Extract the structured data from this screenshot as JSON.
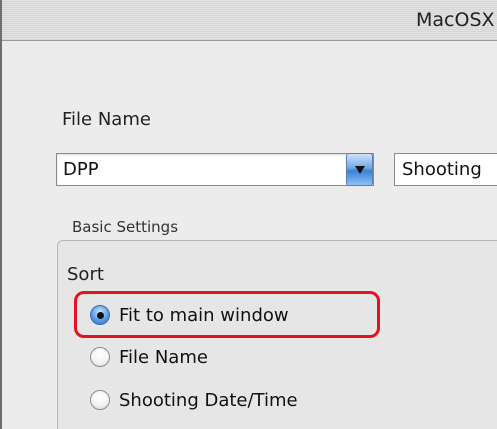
{
  "window": {
    "title": "MacOSX"
  },
  "file_name": {
    "label": "File Name",
    "combo_value": "DPP",
    "second_select_value": "Shooting"
  },
  "basic_settings": {
    "title": "Basic Settings",
    "sort": {
      "label": "Sort",
      "options": [
        {
          "label": "Fit to main window",
          "selected": true
        },
        {
          "label": "File Name",
          "selected": false
        },
        {
          "label": "Shooting Date/Time",
          "selected": false
        }
      ]
    }
  },
  "colors": {
    "highlight": "#e3141b",
    "radio_selected": "#3a82d8",
    "window_bg": "#ececec"
  },
  "icons": {
    "combo_arrow": "chevron-down-icon",
    "radio_dot": "radio-dot-icon"
  }
}
